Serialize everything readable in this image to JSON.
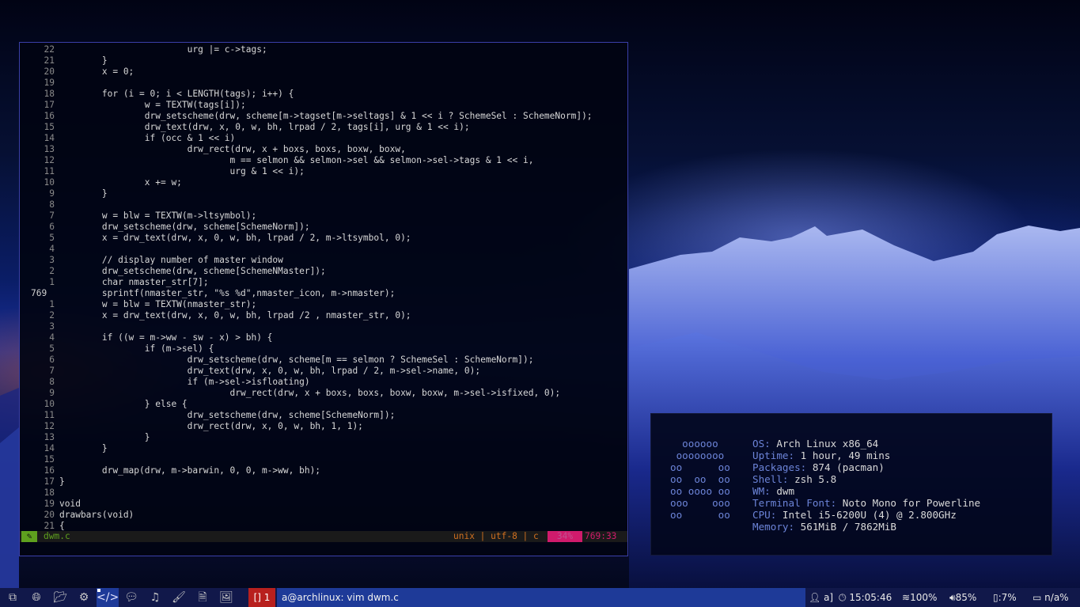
{
  "editor": {
    "lines": [
      {
        "n": "22",
        "text": "                        urg |= c->tags;"
      },
      {
        "n": "21",
        "text": "        }"
      },
      {
        "n": "20",
        "text": "        x = 0;"
      },
      {
        "n": "19",
        "text": ""
      },
      {
        "n": "18",
        "text": "        for (i = 0; i < LENGTH(tags); i++) {"
      },
      {
        "n": "17",
        "text": "                w = TEXTW(tags[i]);"
      },
      {
        "n": "16",
        "text": "                drw_setscheme(drw, scheme[m->tagset[m->seltags] & 1 << i ? SchemeSel : SchemeNorm]);"
      },
      {
        "n": "15",
        "text": "                drw_text(drw, x, 0, w, bh, lrpad / 2, tags[i], urg & 1 << i);"
      },
      {
        "n": "14",
        "text": "                if (occ & 1 << i)"
      },
      {
        "n": "13",
        "text": "                        drw_rect(drw, x + boxs, boxs, boxw, boxw,"
      },
      {
        "n": "12",
        "text": "                                m == selmon && selmon->sel && selmon->sel->tags & 1 << i,"
      },
      {
        "n": "11",
        "text": "                                urg & 1 << i);"
      },
      {
        "n": "10",
        "text": "                x += w;"
      },
      {
        "n": "9",
        "text": "        }"
      },
      {
        "n": "8",
        "text": ""
      },
      {
        "n": "7",
        "text": "        w = blw = TEXTW(m->ltsymbol);"
      },
      {
        "n": "6",
        "text": "        drw_setscheme(drw, scheme[SchemeNorm]);"
      },
      {
        "n": "5",
        "text": "        x = drw_text(drw, x, 0, w, bh, lrpad / 2, m->ltsymbol, 0);"
      },
      {
        "n": "4",
        "text": ""
      },
      {
        "n": "3",
        "text": "        // display number of master window"
      },
      {
        "n": "2",
        "text": "        drw_setscheme(drw, scheme[SchemeNMaster]);"
      },
      {
        "n": "1",
        "text": "        char nmaster_str[7];"
      },
      {
        "n": "769",
        "text": "        sprintf(nmaster_str, \"%s %d\",nmaster_icon, m->nmaster);"
      },
      {
        "n": "1",
        "text": "        w = blw = TEXTW(nmaster_str);"
      },
      {
        "n": "2",
        "text": "        x = drw_text(drw, x, 0, w, bh, lrpad /2 , nmaster_str, 0);"
      },
      {
        "n": "3",
        "text": ""
      },
      {
        "n": "4",
        "text": "        if ((w = m->ww - sw - x) > bh) {"
      },
      {
        "n": "5",
        "text": "                if (m->sel) {"
      },
      {
        "n": "6",
        "text": "                        drw_setscheme(drw, scheme[m == selmon ? SchemeSel : SchemeNorm]);"
      },
      {
        "n": "7",
        "text": "                        drw_text(drw, x, 0, w, bh, lrpad / 2, m->sel->name, 0);"
      },
      {
        "n": "8",
        "text": "                        if (m->sel->isfloating)"
      },
      {
        "n": "9",
        "text": "                                drw_rect(drw, x + boxs, boxs, boxw, boxw, m->sel->isfixed, 0);"
      },
      {
        "n": "10",
        "text": "                } else {"
      },
      {
        "n": "11",
        "text": "                        drw_setscheme(drw, scheme[SchemeNorm]);"
      },
      {
        "n": "12",
        "text": "                        drw_rect(drw, x, 0, w, bh, 1, 1);"
      },
      {
        "n": "13",
        "text": "                }"
      },
      {
        "n": "14",
        "text": "        }"
      },
      {
        "n": "15",
        "text": ""
      },
      {
        "n": "16",
        "text": "        drw_map(drw, m->barwin, 0, 0, m->ww, bh);"
      },
      {
        "n": "17",
        "text": "}"
      },
      {
        "n": "18",
        "text": ""
      },
      {
        "n": "19",
        "text": "void"
      },
      {
        "n": "20",
        "text": "drawbars(void)"
      },
      {
        "n": "21",
        "text": "{"
      }
    ],
    "current_line_index": 22,
    "status": {
      "mode_icon": "✎",
      "filename": "dwm.c",
      "fileinfo": "unix | utf-8 | c",
      "percent": "34%",
      "position": "769:33"
    }
  },
  "neofetch": {
    "logo": [
      "  oooooo",
      " oooooooo",
      "oo      oo",
      "oo  oo  oo",
      "oo oooo oo",
      "ooo    ooo",
      "oo      oo"
    ],
    "info": [
      {
        "key": "OS:",
        "value": " Arch Linux x86_64"
      },
      {
        "key": "Uptime:",
        "value": " 1 hour, 49 mins"
      },
      {
        "key": "Packages:",
        "value": " 874 (pacman)"
      },
      {
        "key": "Shell:",
        "value": " zsh 5.8"
      },
      {
        "key": "WM:",
        "value": " dwm"
      },
      {
        "key": "Terminal Font:",
        "value": " Noto Mono for Powerline"
      },
      {
        "key": "CPU:",
        "value": " Intel i5-6200U (4) @ 2.800GHz"
      },
      {
        "key": "Memory:",
        "value": " 561MiB / 7862MiB"
      }
    ]
  },
  "taskbar": {
    "tags": [
      {
        "icon": "windows-icon",
        "glyph": "⧉",
        "selected": false
      },
      {
        "icon": "globe-icon",
        "glyph": "🌐︎",
        "selected": false
      },
      {
        "icon": "folder-icon",
        "glyph": "📂︎",
        "selected": false
      },
      {
        "icon": "puzzle-icon",
        "glyph": "⚙",
        "selected": false
      },
      {
        "icon": "code-icon",
        "glyph": "</>",
        "selected": true
      },
      {
        "icon": "chat-icon",
        "glyph": "💬︎",
        "selected": false
      },
      {
        "icon": "music-icon",
        "glyph": "♫",
        "selected": false
      },
      {
        "icon": "brush-icon",
        "glyph": "🖌︎",
        "selected": false
      },
      {
        "icon": "document-icon",
        "glyph": "🗎",
        "selected": false
      },
      {
        "icon": "image-icon",
        "glyph": "🖼︎",
        "selected": false
      }
    ],
    "layout_symbol": "[] 1",
    "window_title": "a@archlinux: vim dwm.c",
    "status": {
      "user": "a]",
      "time": "15:05:46",
      "wifi": "100%",
      "volume": "85%",
      "battery": ":7%",
      "screen": "n/a%"
    }
  }
}
